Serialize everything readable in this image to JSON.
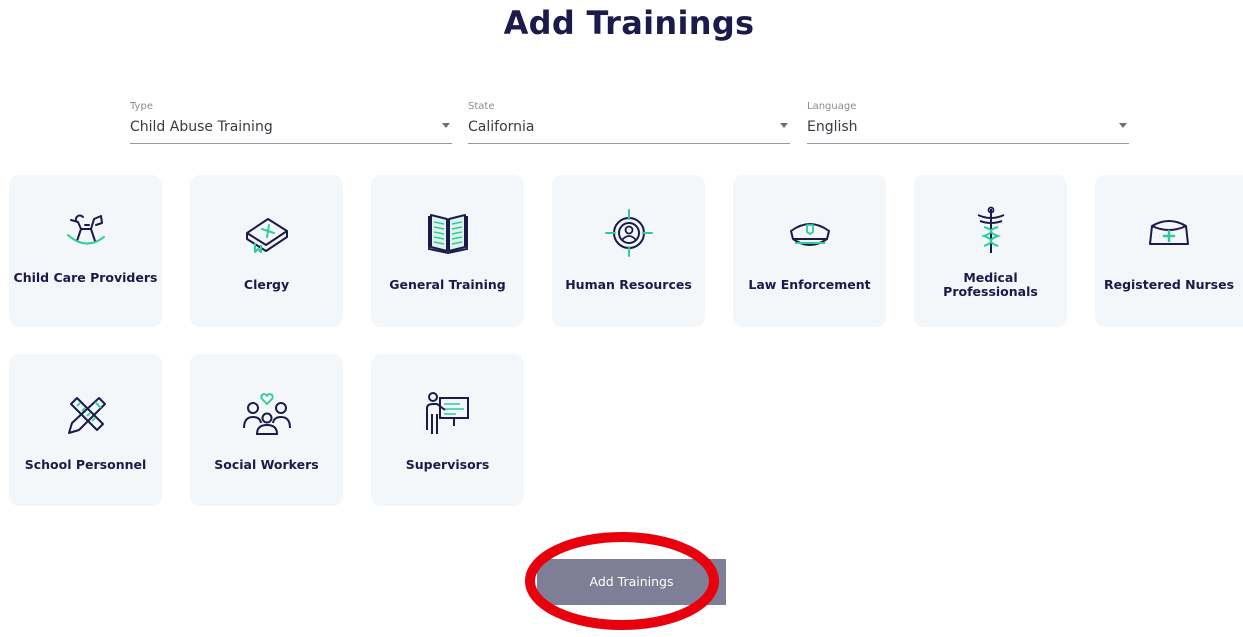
{
  "page": {
    "title": "Add Trainings"
  },
  "filters": [
    {
      "label": "Type",
      "value": "Child Abuse Training"
    },
    {
      "label": "State",
      "value": "California"
    },
    {
      "label": "Language",
      "value": "English"
    }
  ],
  "cards": [
    {
      "label": "Child Care Providers",
      "icon": "rocking-horse-icon"
    },
    {
      "label": "Clergy",
      "icon": "bible-icon"
    },
    {
      "label": "General Training",
      "icon": "open-book-icon"
    },
    {
      "label": "Human Resources",
      "icon": "target-person-icon"
    },
    {
      "label": "Law Enforcement",
      "icon": "police-cap-icon"
    },
    {
      "label": "Medical Professionals",
      "icon": "caduceus-icon"
    },
    {
      "label": "Registered Nurses",
      "icon": "nurse-cap-icon"
    },
    {
      "label": "School Personnel",
      "icon": "pencil-ruler-icon"
    },
    {
      "label": "Social Workers",
      "icon": "people-heart-icon"
    },
    {
      "label": "Supervisors",
      "icon": "presenter-board-icon"
    }
  ],
  "actions": {
    "submit_label": "Add Trainings"
  },
  "colors": {
    "heading": "#1b1a4a",
    "accent": "#2ecc9a",
    "card_bg": "#f3f7fa",
    "button_bg": "#7f7e97",
    "highlight_ring": "#e8000c"
  }
}
